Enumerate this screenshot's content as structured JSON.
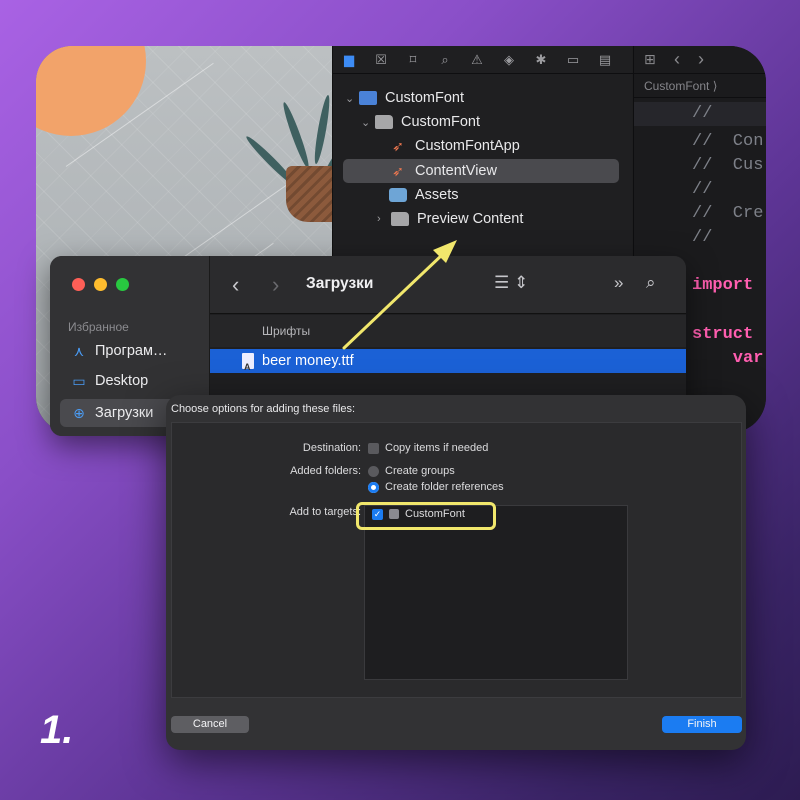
{
  "navigator": {
    "tree": [
      {
        "label": "CustomFont",
        "type": "project",
        "expanded": true
      },
      {
        "label": "CustomFont",
        "type": "folder",
        "expanded": true
      },
      {
        "label": "CustomFontApp",
        "type": "swift"
      },
      {
        "label": "ContentView",
        "type": "swift",
        "selected": true
      },
      {
        "label": "Assets",
        "type": "assets"
      },
      {
        "label": "Preview Content",
        "type": "folder",
        "expanded": false
      }
    ]
  },
  "editor": {
    "breadcrumb": "CustomFont ⟩",
    "code_lines": [
      "//",
      "//  Con",
      "//  Cus",
      "//",
      "//  Cre",
      "//",
      "",
      "import",
      "",
      "struct",
      "    var"
    ]
  },
  "finder": {
    "sidebar_section": "Избранное",
    "sidebar_items": [
      {
        "label": "Програм…",
        "icon": "applications-icon"
      },
      {
        "label": "Desktop",
        "icon": "desktop-icon"
      },
      {
        "label": "Загрузки",
        "icon": "downloads-icon",
        "selected": true
      }
    ],
    "title": "Загрузки",
    "group_header": "Шрифты",
    "selected_file": "beer money.ttf"
  },
  "dialog": {
    "title": "Choose options for adding these files:",
    "destination_label": "Destination:",
    "copy_items_label": "Copy items if needed",
    "copy_items_checked": false,
    "added_folders_label": "Added folders:",
    "create_groups_label": "Create groups",
    "create_folder_refs_label": "Create folder references",
    "selected_folder_option": "Create folder references",
    "add_to_targets_label": "Add to targets:",
    "target_name": "CustomFont",
    "target_checked": true,
    "cancel_label": "Cancel",
    "finish_label": "Finish"
  },
  "step_label": "1.",
  "colors": {
    "accent": "#1b7cf2",
    "selection": "#1b61d6",
    "highlight_annotation": "#f1e76c",
    "keyword": "#ff5eb0"
  }
}
